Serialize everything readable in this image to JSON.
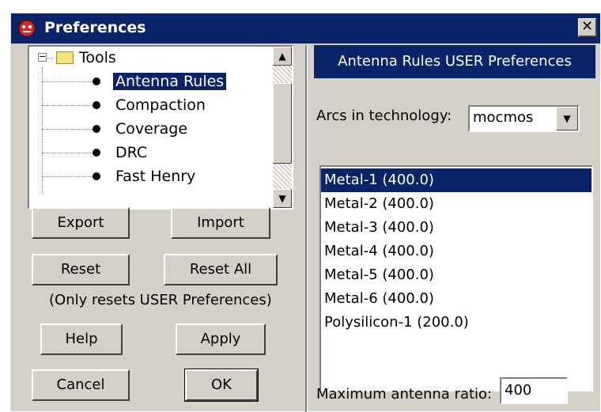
{
  "window": {
    "title": "Preferences",
    "close_glyph": "✕"
  },
  "tree": {
    "root": {
      "label": "Tools",
      "expander": "−"
    },
    "items": [
      {
        "label": "Antenna Rules",
        "selected": true
      },
      {
        "label": "Compaction"
      },
      {
        "label": "Coverage"
      },
      {
        "label": "DRC"
      },
      {
        "label": "Fast Henry"
      }
    ],
    "scroll_up": "▲",
    "scroll_down": "▼"
  },
  "buttons": {
    "export": "Export",
    "import": "Import",
    "reset": "Reset",
    "reset_all": "Reset All",
    "reset_note": "(Only resets USER Preferences)",
    "help": "Help",
    "apply": "Apply",
    "cancel": "Cancel",
    "ok": "OK"
  },
  "panel": {
    "header": "Antenna Rules USER Preferences",
    "arcs_label": "Arcs in technology:",
    "technology": "mocmos",
    "combo_arrow": "▼",
    "arcs": [
      {
        "label": "Metal-1 (400.0)",
        "selected": true
      },
      {
        "label": "Metal-2 (400.0)"
      },
      {
        "label": "Metal-3 (400.0)"
      },
      {
        "label": "Metal-4 (400.0)"
      },
      {
        "label": "Metal-5 (400.0)"
      },
      {
        "label": "Metal-6 (400.0)"
      },
      {
        "label": "Polysilicon-1 (200.0)"
      }
    ],
    "max_ratio_label": "Maximum antenna ratio:",
    "max_ratio_value": "400"
  },
  "colors": {
    "titlebar": "#0a246a",
    "selection": "#0a246a",
    "face": "#d4d0c8"
  },
  "icons": {
    "app": "app-icon",
    "folder": "folder-icon",
    "bullet": "bullet-icon"
  }
}
